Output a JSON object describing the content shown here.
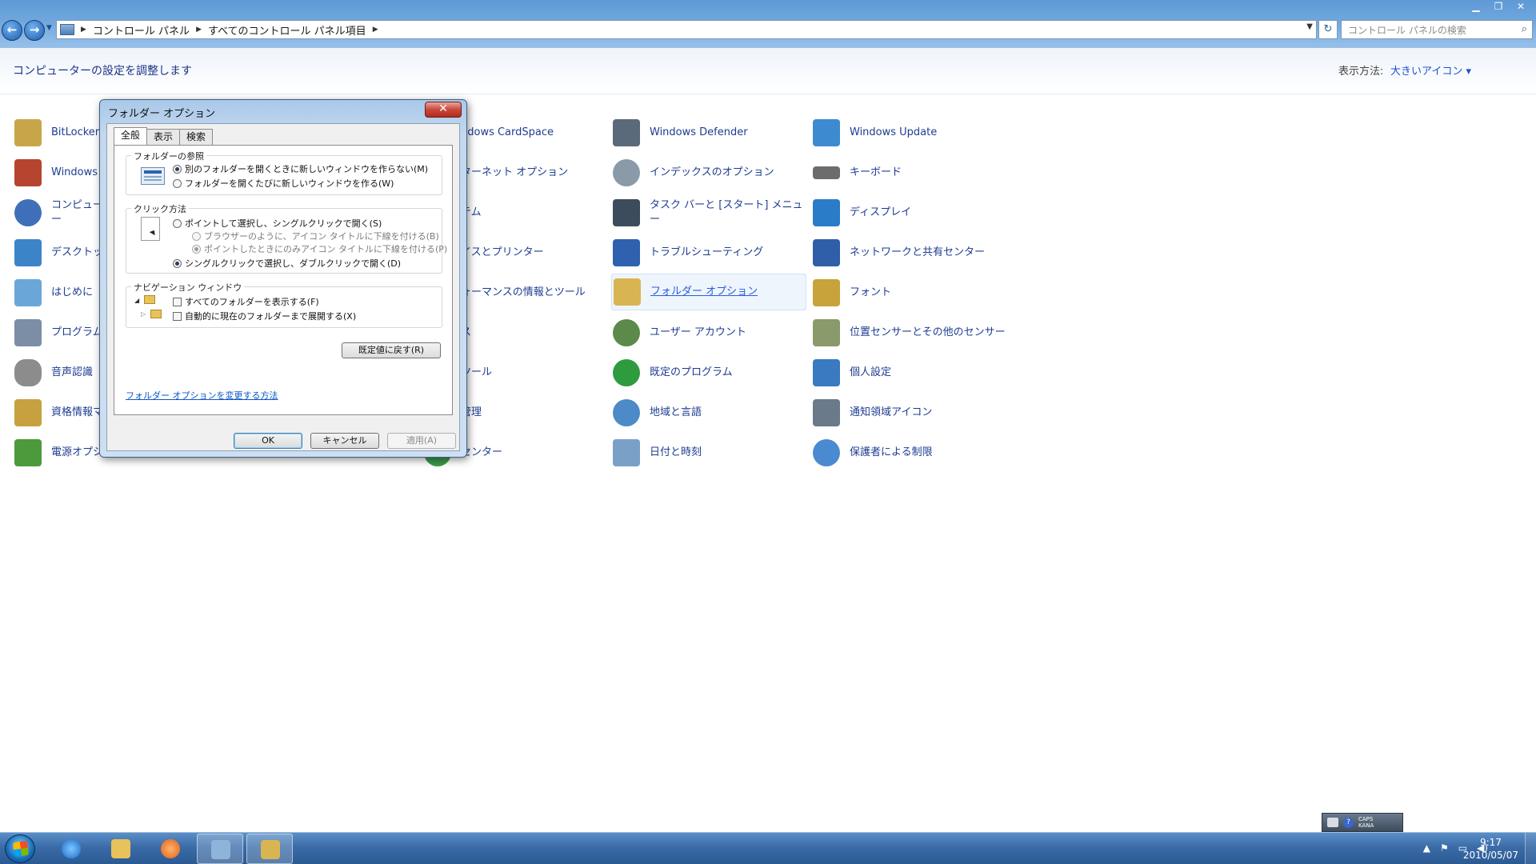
{
  "address": {
    "crumbs": [
      "コントロール パネル",
      "すべてのコントロール パネル項目"
    ],
    "search_placeholder": "コントロール パネルの検索"
  },
  "header": {
    "title": "コンピューターの設定を調整します",
    "view_label": "表示方法:",
    "view_value": "大きいアイコン ▾"
  },
  "items": [
    {
      "label": "BitLocker",
      "color": "#c9a54a"
    },
    {
      "label": "Windows フ",
      "color": "#b5452e"
    },
    {
      "label": "コンピュー\nー",
      "color": "#3e6fb8"
    },
    {
      "label": "デスクトッ",
      "color": "#3c84c8"
    },
    {
      "label": "はじめに",
      "color": "#6aa7d8"
    },
    {
      "label": "プログラム",
      "color": "#7b8ea6"
    },
    {
      "label": "音声認識",
      "color": "#8c8c8c"
    },
    {
      "label": "資格情報マ",
      "color": "#c7a040"
    },
    {
      "label": "電源オプシ",
      "color": "#4c9a3c"
    },
    {
      "label": "ndows CardSpace",
      "color": "#3b6fb5"
    },
    {
      "label": "ターネット オプション",
      "color": "#2f7ec9"
    },
    {
      "label": "テム",
      "color": "#5b7fa8"
    },
    {
      "label": "イスとプリンター",
      "color": "#6c7c8c"
    },
    {
      "label": "ォーマンスの情報とツール",
      "color": "#4e86c2"
    },
    {
      "label": "ス",
      "color": "#7a8a9a"
    },
    {
      "label": "ツール",
      "color": "#6b7b8b"
    },
    {
      "label": "管理",
      "color": "#6a8ab0"
    },
    {
      "label": "センター",
      "color": "#3a9a4a"
    },
    {
      "label": "Windows Defender",
      "color": "#5a6a7a"
    },
    {
      "label": "インデックスのオプション",
      "color": "#8a9aa8"
    },
    {
      "label": "タスク バーと [スタート] メニュ\nー",
      "color": "#3c4c5c"
    },
    {
      "label": "トラブルシューティング",
      "color": "#2e62b0"
    },
    {
      "label": "フォルダー オプション",
      "color": "#d9b453"
    },
    {
      "label": "ユーザー アカウント",
      "color": "#5b8a4a"
    },
    {
      "label": "既定のプログラム",
      "color": "#2f9b3f"
    },
    {
      "label": "地域と言語",
      "color": "#4c8ac8"
    },
    {
      "label": "日付と時刻",
      "color": "#7aa0c8"
    },
    {
      "label": "Windows Update",
      "color": "#3e8ad0"
    },
    {
      "label": "キーボード",
      "color": "#6c6c6c"
    },
    {
      "label": "ディスプレイ",
      "color": "#2a7cc8"
    },
    {
      "label": "ネットワークと共有センター",
      "color": "#2e5fa8"
    },
    {
      "label": "フォント",
      "color": "#c8a23a"
    },
    {
      "label": "位置センサーとその他のセンサー",
      "color": "#8a9a6a"
    },
    {
      "label": "個人設定",
      "color": "#3a7ac0"
    },
    {
      "label": "通知領域アイコン",
      "color": "#6a7a8a"
    },
    {
      "label": "保護者による制限",
      "color": "#4a8ad0"
    }
  ],
  "dialog": {
    "title": "フォルダー オプション",
    "tabs": [
      "全般",
      "表示",
      "検索"
    ],
    "browse_group": "フォルダーの参照",
    "browse_same": "別のフォルダーを開くときに新しいウィンドウを作らない(M)",
    "browse_new": "フォルダーを開くたびに新しいウィンドウを作る(W)",
    "click_group": "クリック方法",
    "click_single": "ポイントして選択し、シングルクリックで開く(S)",
    "underline_browser": "ブラウザーのように、アイコン タイトルに下線を付ける(B)",
    "underline_point": "ポイントしたときにのみアイコン タイトルに下線を付ける(P)",
    "click_double": "シングルクリックで選択し、ダブルクリックで開く(D)",
    "nav_group": "ナビゲーション ウィンドウ",
    "show_all": "すべてのフォルダーを表示する(F)",
    "auto_expand": "自動的に現在のフォルダーまで展開する(X)",
    "reset": "既定値に戻す(R)",
    "help": "フォルダー オプションを変更する方法",
    "ok": "OK",
    "cancel": "キャンセル",
    "apply": "適用(A)"
  },
  "langbar": {
    "caps": "CAPS",
    "kana": "KANA"
  },
  "clock": {
    "time": "9:17",
    "date": "2010/05/07"
  }
}
